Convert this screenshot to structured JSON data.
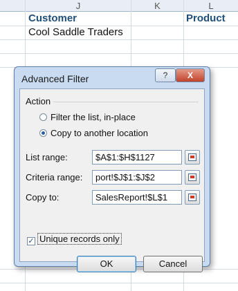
{
  "sheet": {
    "columns": [
      "J",
      "K",
      "L"
    ],
    "cells": {
      "j2": "Customer",
      "l2": "Product",
      "j3": "Cool Saddle Traders"
    }
  },
  "dialog": {
    "title": "Advanced Filter",
    "help_label": "?",
    "close_label": "X",
    "action_group": "Action",
    "radio_filter": "Filter the list, in-place",
    "radio_copy": "Copy to another location",
    "selected_action": "Copy to another location",
    "list_range_label": "List range:",
    "list_range_value": "$A$1:$H$1127",
    "criteria_range_label": "Criteria range:",
    "criteria_range_value": "port!$J$1:$J$2",
    "copy_to_label": "Copy to:",
    "copy_to_value": "SalesReport!$L$1",
    "unique_label": "Unique records only",
    "unique_checked": true,
    "ok_label": "OK",
    "cancel_label": "Cancel",
    "ref_button_icon": "collapse-dialog-icon"
  }
}
